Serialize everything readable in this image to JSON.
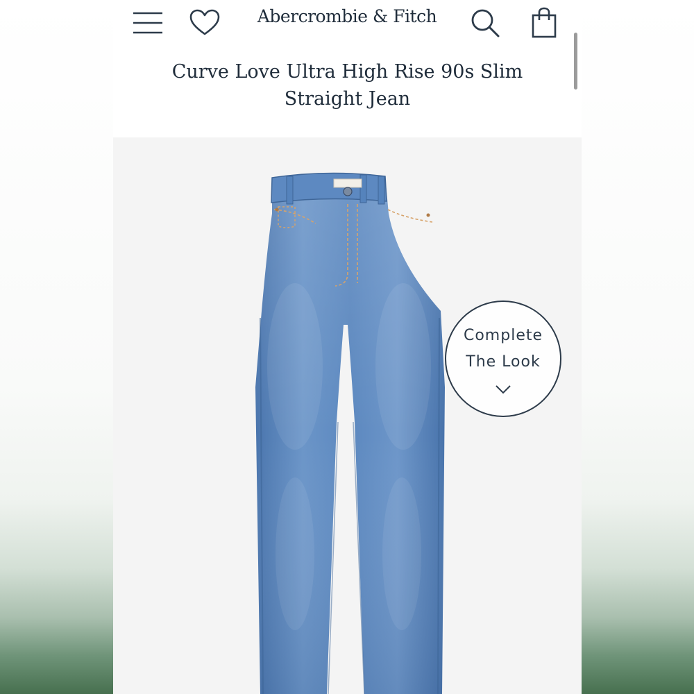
{
  "header": {
    "brand": "Abercrombie & Fitch",
    "icons": [
      "menu-icon",
      "heart-icon",
      "search-icon",
      "bag-icon"
    ]
  },
  "product": {
    "title": "Curve Love Ultra High Rise 90s Slim Straight Jean"
  },
  "complete_look": {
    "label": "Complete The Look",
    "icon": "chevron-down-icon"
  },
  "colors": {
    "brand_navy": "#1f2c3a",
    "denim": "#5a86bf",
    "page_background": "#f4f4f4",
    "outer_green": "#47704f"
  }
}
